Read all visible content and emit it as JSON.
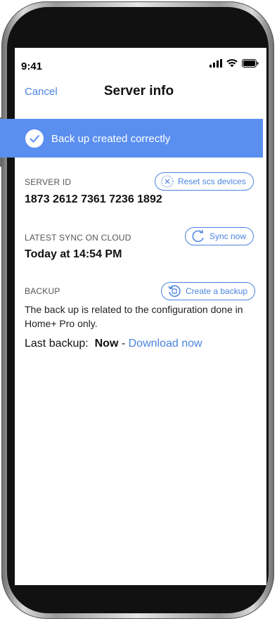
{
  "status_bar": {
    "time": "9:41"
  },
  "nav": {
    "cancel_label": "Cancel",
    "title": "Server info"
  },
  "banner": {
    "message": "Back up created correctly"
  },
  "server_id": {
    "label": "SERVER ID",
    "value": "1873 2612 7361 7236 1892",
    "action_label": "Reset scs devices"
  },
  "sync": {
    "label": "LATEST SYNC ON CLOUD",
    "value": "Today at 14:54 PM",
    "action_label": "Sync now"
  },
  "backup": {
    "label": "BACKUP",
    "action_label": "Create a backup",
    "description": "The back up is related to the configuration done in Home+ Pro only.",
    "last_backup_label": "Last backup:",
    "last_backup_value": "Now",
    "separator": " - ",
    "download_label": "Download now"
  },
  "colors": {
    "accent": "#4a84e0",
    "banner_bg": "#5a8ff0"
  }
}
